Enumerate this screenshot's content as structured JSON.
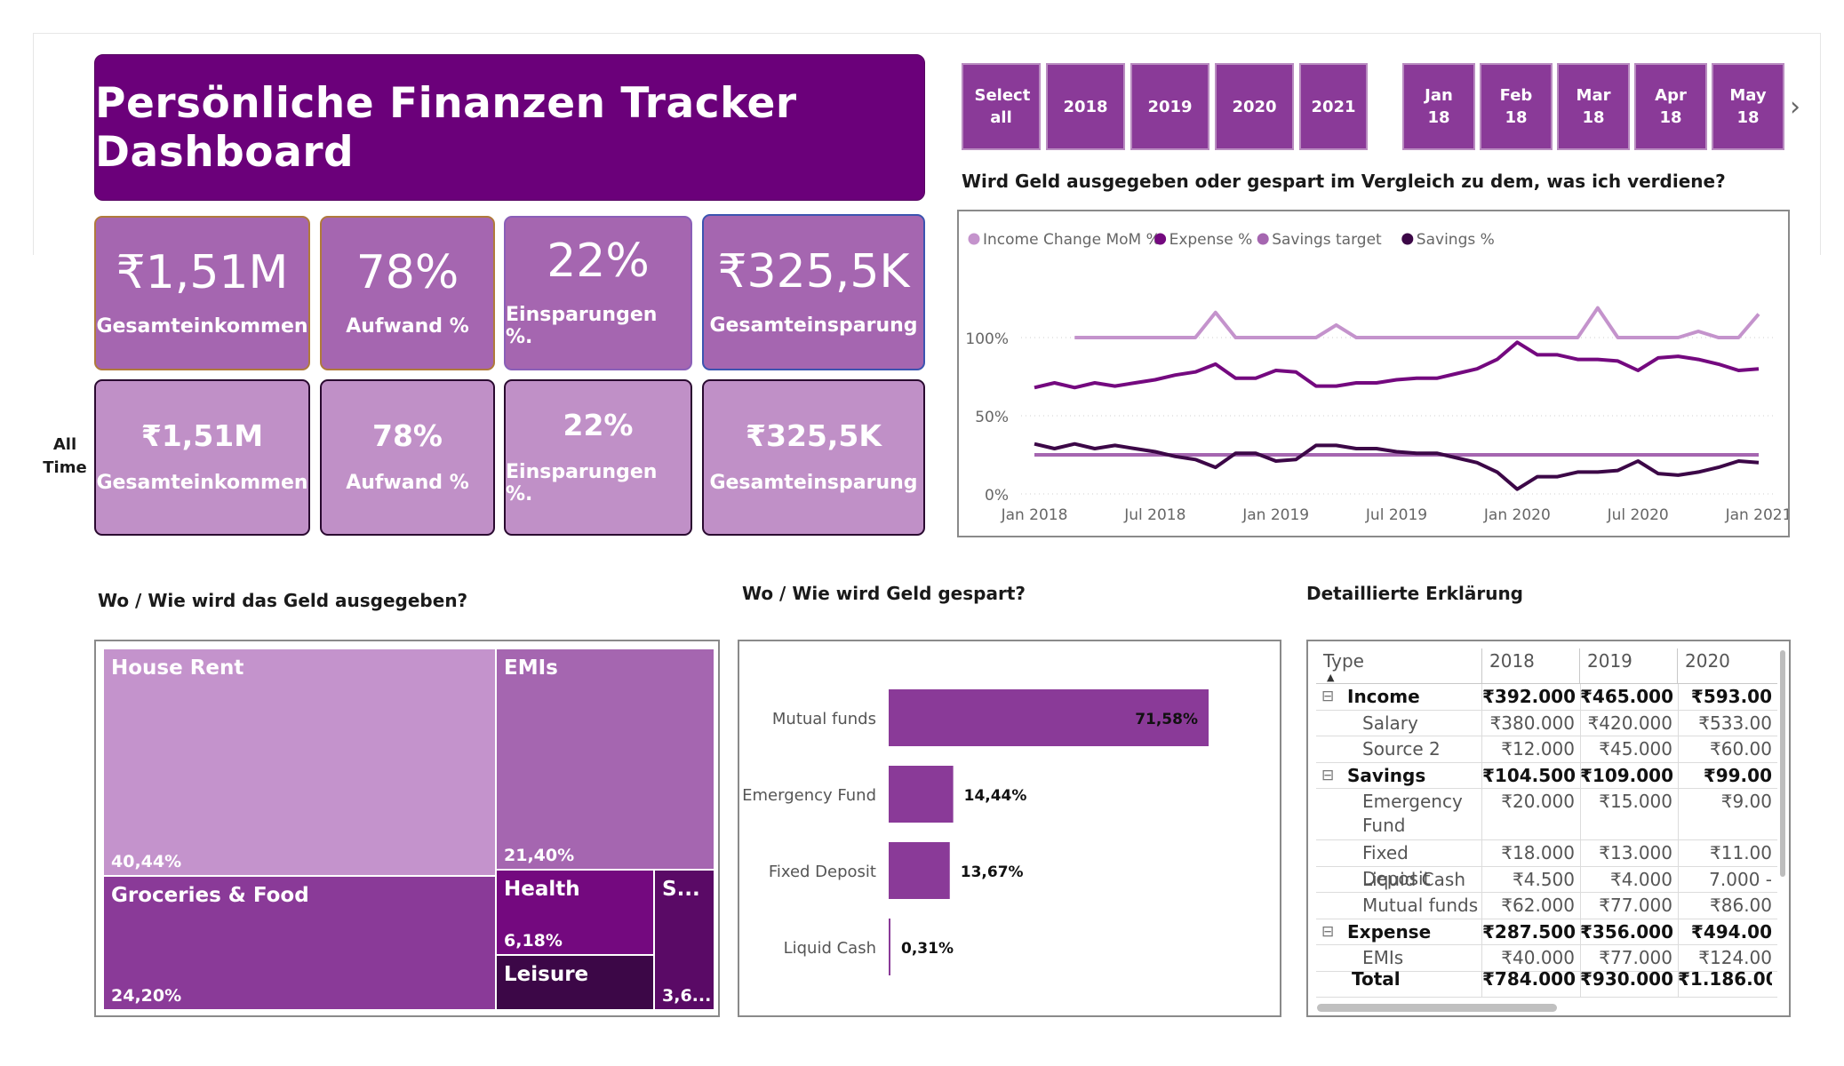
{
  "title": "Persönliche Finanzen Tracker Dashboard",
  "kpi_top": [
    {
      "value": "₹1,51M",
      "label": "Gesamteinkommen"
    },
    {
      "value": "78%",
      "label": "Aufwand %"
    },
    {
      "value": "22%",
      "label": "Einsparungen %."
    },
    {
      "value": "₹325,5K",
      "label": "Gesamteinsparung"
    }
  ],
  "kpi_bottom": [
    {
      "value": "₹1,51M",
      "label": "Gesamteinkommen"
    },
    {
      "value": "78%",
      "label": "Aufwand %"
    },
    {
      "value": "22%",
      "label": "Einsparungen %."
    },
    {
      "value": "₹325,5K",
      "label": "Gesamteinsparung"
    }
  ],
  "all_time_label": "All Time",
  "year_slicer": [
    "Select all",
    "2018",
    "2019",
    "2020",
    "2021"
  ],
  "month_slicer": [
    "Jan 18",
    "Feb 18",
    "Mar 18",
    "Apr 18",
    "May 18"
  ],
  "line_chart_title": "Wird Geld ausgegeben oder gespart im Vergleich zu dem, was ich verdiene?",
  "chart_data": {
    "type": "line",
    "x": [
      "Jan 2018",
      "Feb 2018",
      "Mar 2018",
      "Apr 2018",
      "May 2018",
      "Jun 2018",
      "Jul 2018",
      "Aug 2018",
      "Sep 2018",
      "Oct 2018",
      "Nov 2018",
      "Dec 2018",
      "Jan 2019",
      "Feb 2019",
      "Mar 2019",
      "Apr 2019",
      "May 2019",
      "Jun 2019",
      "Jul 2019",
      "Aug 2019",
      "Sep 2019",
      "Oct 2019",
      "Nov 2019",
      "Dec 2019",
      "Jan 2020",
      "Feb 2020",
      "Mar 2020",
      "Apr 2020",
      "May 2020",
      "Jun 2020",
      "Jul 2020",
      "Aug 2020",
      "Sep 2020",
      "Oct 2020",
      "Nov 2020",
      "Dec 2020",
      "Jan 2021"
    ],
    "x_ticks": [
      "Jan 2018",
      "Jul 2018",
      "Jan 2019",
      "Jul 2019",
      "Jan 2020",
      "Jul 2020",
      "Jan 2021"
    ],
    "y_ticks": [
      "0%",
      "50%",
      "100%"
    ],
    "ylim": [
      0,
      130
    ],
    "series": [
      {
        "name": "Income Change MoM %",
        "color": "#c493cc",
        "values": [
          null,
          null,
          100,
          100,
          100,
          100,
          100,
          100,
          100,
          116,
          100,
          100,
          100,
          100,
          100,
          108,
          100,
          100,
          100,
          100,
          100,
          100,
          100,
          100,
          100,
          100,
          100,
          100,
          119,
          100,
          100,
          100,
          100,
          104,
          100,
          100,
          115,
          100,
          100
        ]
      },
      {
        "name": "Expense %",
        "color": "#74097f",
        "values": [
          68,
          71,
          68,
          71,
          69,
          71,
          73,
          76,
          78,
          83,
          74,
          74,
          79,
          78,
          69,
          69,
          71,
          71,
          73,
          74,
          74,
          77,
          80,
          86,
          97,
          89,
          89,
          86,
          86,
          85,
          79,
          87,
          88,
          86,
          83,
          79,
          80,
          78
        ]
      },
      {
        "name": "Savings target",
        "color": "#a566b0",
        "values": [
          25,
          25,
          25,
          25,
          25,
          25,
          25,
          25,
          25,
          25,
          25,
          25,
          25,
          25,
          25,
          25,
          25,
          25,
          25,
          25,
          25,
          25,
          25,
          25,
          25,
          25,
          25,
          25,
          25,
          25,
          25,
          25,
          25,
          25,
          25,
          25,
          25,
          25
        ]
      },
      {
        "name": "Savings %",
        "color": "#3c0747",
        "values": [
          32,
          29,
          32,
          29,
          31,
          29,
          27,
          24,
          22,
          17,
          26,
          26,
          21,
          22,
          31,
          31,
          29,
          29,
          27,
          26,
          26,
          23,
          20,
          14,
          3,
          11,
          11,
          14,
          14,
          15,
          21,
          13,
          12,
          14,
          17,
          21,
          20,
          22
        ]
      }
    ]
  },
  "treemap_title": "Wo / Wie wird das Geld ausgegeben?",
  "treemap": [
    {
      "name": "House Rent",
      "pct": "40,44%"
    },
    {
      "name": "EMIs",
      "pct": "21,40%"
    },
    {
      "name": "Groceries & Food",
      "pct": "24,20%"
    },
    {
      "name": "Health",
      "pct": "6,18%"
    },
    {
      "name": "Leisure",
      "pct": ""
    },
    {
      "name": "S...",
      "pct": "3,6..."
    }
  ],
  "bar_title": "Wo / Wie wird Geld gespart?",
  "bar_data": {
    "categories": [
      "Mutual funds",
      "Emergency Fund",
      "Fixed Deposit",
      "Liquid Cash"
    ],
    "values": [
      71.58,
      14.44,
      13.67,
      0.31
    ],
    "labels": [
      "71,58%",
      "14,44%",
      "13,67%",
      "0,31%"
    ],
    "color": "#8a3a98"
  },
  "table_title": "Detaillierte Erklärung",
  "table": {
    "headers": [
      "Type",
      "2018",
      "2019",
      "2020"
    ],
    "rows": [
      {
        "label": "Income",
        "bold": true,
        "expander": "⊟",
        "values": [
          "₹392.000",
          "₹465.000",
          "₹593.00"
        ]
      },
      {
        "label": "Salary",
        "bold": false,
        "values": [
          "₹380.000",
          "₹420.000",
          "₹533.00"
        ]
      },
      {
        "label": "Source 2",
        "bold": false,
        "values": [
          "₹12.000",
          "₹45.000",
          "₹60.00"
        ]
      },
      {
        "label": "Savings",
        "bold": true,
        "expander": "⊟",
        "values": [
          "₹104.500",
          "₹109.000",
          "₹99.00"
        ]
      },
      {
        "label": "Emergency",
        "label2": "Fund",
        "bold": false,
        "values": [
          "₹20.000",
          "₹15.000",
          "₹9.00"
        ]
      },
      {
        "label": "Fixed Deposit",
        "bold": false,
        "values": [
          "₹18.000",
          "₹13.000",
          "₹11.00"
        ]
      },
      {
        "label": "Liquid Cash",
        "bold": false,
        "values": [
          "₹4.500",
          "₹4.000",
          "7.000 -"
        ]
      },
      {
        "label": "Mutual funds",
        "bold": false,
        "values": [
          "₹62.000",
          "₹77.000",
          "₹86.00"
        ]
      },
      {
        "label": "Expense",
        "bold": true,
        "expander": "⊟",
        "values": [
          "₹287.500",
          "₹356.000",
          "₹494.00"
        ]
      },
      {
        "label": "EMIs",
        "bold": false,
        "values": [
          "₹40.000",
          "₹77.000",
          "₹124.00"
        ]
      }
    ],
    "total": {
      "label": "Total",
      "values": [
        "₹784.000",
        "₹930.000",
        "₹1.186.00"
      ]
    }
  }
}
